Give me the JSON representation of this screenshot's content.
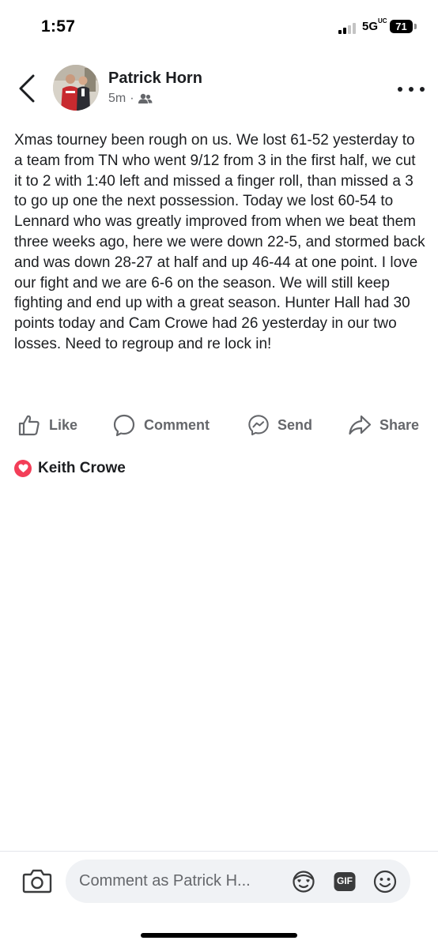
{
  "status_bar": {
    "time": "1:57",
    "network": "5G",
    "network_suffix": "UC",
    "battery": "71"
  },
  "post": {
    "author": "Patrick Horn",
    "timestamp": "5m",
    "separator": "·",
    "audience_icon": "friends-icon",
    "text": "Xmas tourney been rough on us.  We lost 61-52 yesterday to a team from TN who went 9/12 from 3 in the first half, we cut it to 2 with 1:40 left and missed a finger roll, than missed a 3 to go up one the next possession.  Today we lost 60-54 to Lennard who was greatly improved from when we beat them three weeks ago, here we were down 22-5, and stormed back and was down 28-27 at half and up 46-44 at one point.  I love our fight and we are 6-6 on the season.  We will still keep fighting and end up with a great season.  Hunter Hall had 30 points today and Cam Crowe had 26 yesterday in our two losses.  Need to regroup and re lock in!"
  },
  "actions": {
    "like": "Like",
    "comment": "Comment",
    "send": "Send",
    "share": "Share"
  },
  "reactions": {
    "type": "love",
    "name": "Keith Crowe"
  },
  "composer": {
    "placeholder": "Comment as Patrick H...",
    "icons": [
      "camera-icon",
      "avatar-sticker-icon",
      "gif-icon",
      "emoji-icon"
    ],
    "gif_label": "GIF"
  },
  "colors": {
    "text_primary": "#1c1e21",
    "text_secondary": "#65676b",
    "love": "#f33e58",
    "composer_bg": "#f0f2f5"
  }
}
